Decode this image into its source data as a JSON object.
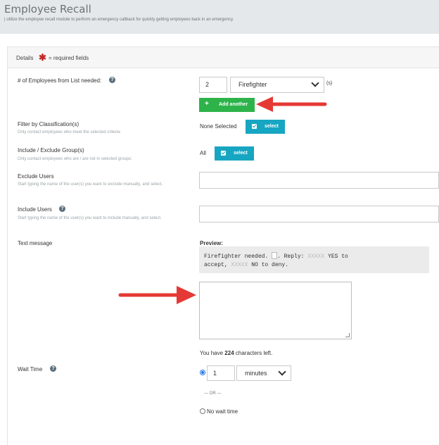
{
  "page": {
    "title": "Employee Recall",
    "subtitle": "| utilize the employee recall module to perform an emergency callback for quickly getting employees back in an emergency."
  },
  "details": {
    "label": "Details",
    "required_star": "✱",
    "required_text": "= required fields"
  },
  "employees_needed": {
    "label": "# of Employees from List needed:",
    "count": "2",
    "position": "Firefighter",
    "suffix": "(s)",
    "add_button": "Add another"
  },
  "classification": {
    "label": "Filter by Classification(s)",
    "help": "Only contact employees who meet the selected criteria:",
    "value": "None Selected",
    "button": "select"
  },
  "groups": {
    "label": "Include / Exclude Group(s)",
    "help": "Only contact employees who are / are not in selected groups:",
    "value": "All",
    "button": "select"
  },
  "exclude_users": {
    "label": "Exclude Users",
    "help": "Start typing the name of the user(s) you want to exclude manually, and select.",
    "value": ""
  },
  "include_users": {
    "label": "Include Users",
    "help": "Start typing the name of the user(s) you want to include manually, and select.",
    "value": ""
  },
  "text_message": {
    "label": "Text message",
    "preview_label": "Preview:",
    "preview_start": "Firefighter needed. ",
    "preview_mid": ". Reply: ",
    "mask1": "XXXXX",
    "preview_yes": " YES to",
    "preview_line2a": "accept, ",
    "mask2": "XXXXX",
    "preview_no": " NO to deny.",
    "value": "",
    "chars_prefix": "You have ",
    "chars_left": "224",
    "chars_suffix": " characters left."
  },
  "wait_time": {
    "label": "Wait Time",
    "value": "1",
    "unit": "minutes",
    "or_text": "— OR —",
    "no_wait": "No wait time"
  },
  "colors": {
    "green": "#2db34a",
    "teal": "#17a6c2",
    "arrow": "#e53935"
  }
}
